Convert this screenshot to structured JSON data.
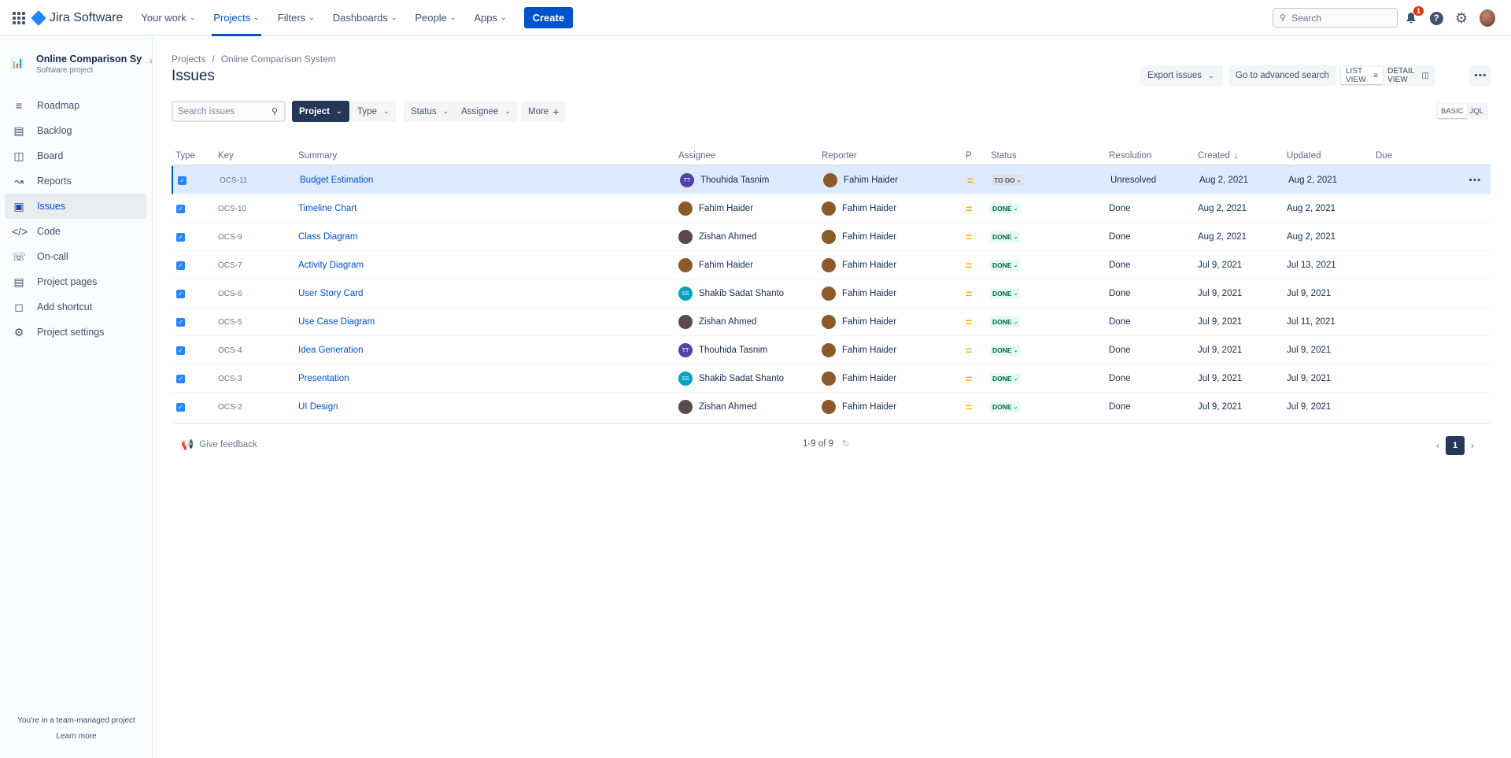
{
  "nav": {
    "logo": "Jira Software",
    "items": [
      {
        "label": "Your work"
      },
      {
        "label": "Projects",
        "active": true
      },
      {
        "label": "Filters"
      },
      {
        "label": "Dashboards"
      },
      {
        "label": "People"
      },
      {
        "label": "Apps"
      }
    ],
    "create": "Create",
    "search_placeholder": "Search",
    "notifications_count": "1",
    "help_icon": "?"
  },
  "sidebar": {
    "project_name": "Online Comparison Syst...",
    "project_type": "Software project",
    "items": [
      {
        "label": "Roadmap",
        "icon": "roadmap-icon"
      },
      {
        "label": "Backlog",
        "icon": "backlog-icon"
      },
      {
        "label": "Board",
        "icon": "board-icon"
      },
      {
        "label": "Reports",
        "icon": "reports-icon"
      },
      {
        "label": "Issues",
        "icon": "issues-icon",
        "active": true
      },
      {
        "label": "Code",
        "icon": "code-icon"
      },
      {
        "label": "On-call",
        "icon": "on-call-icon"
      },
      {
        "label": "Project pages",
        "icon": "pages-icon"
      },
      {
        "label": "Add shortcut",
        "icon": "add-shortcut-icon"
      },
      {
        "label": "Project settings",
        "icon": "settings-icon"
      }
    ],
    "footer_text": "You're in a team-managed project",
    "learn_more": "Learn more"
  },
  "main": {
    "breadcrumb": [
      "Projects",
      "Online Comparison System"
    ],
    "title": "Issues",
    "export": "Export issues",
    "advanced_search": "Go to advanced search",
    "list_view": "LIST VIEW",
    "detail_view": "DETAIL VIEW",
    "search_placeholder": "Search issues",
    "filters": {
      "project": "Project",
      "type": "Type",
      "status": "Status",
      "assignee": "Assignee",
      "more": "More"
    },
    "basic": "BASIC",
    "jql": "JQL"
  },
  "table": {
    "columns": {
      "type": "Type",
      "key": "Key",
      "summary": "Summary",
      "assignee": "Assignee",
      "reporter": "Reporter",
      "priority": "P",
      "status": "Status",
      "resolution": "Resolution",
      "created": "Created",
      "updated": "Updated",
      "due": "Due"
    },
    "rows": [
      {
        "key": "OCS-11",
        "summary": "Budget Estimation",
        "assignee": "Thouhida Tasnim",
        "assignee_initials": "TT",
        "assignee_color": "#5243aa",
        "reporter": "Fahim Haider",
        "status": "TO DO",
        "resolution": "Unresolved",
        "created": "Aug 2, 2021",
        "updated": "Aug 2, 2021"
      },
      {
        "key": "OCS-10",
        "summary": "Timeline Chart",
        "assignee": "Fahim Haider",
        "assignee_initials": "",
        "assignee_color": "#8b5a2b",
        "reporter": "Fahim Haider",
        "status": "DONE",
        "resolution": "Done",
        "created": "Aug 2, 2021",
        "updated": "Aug 2, 2021"
      },
      {
        "key": "OCS-9",
        "summary": "Class Diagram",
        "assignee": "Zishan Ahmed",
        "assignee_initials": "",
        "assignee_color": "#5a4a4a",
        "reporter": "Fahim Haider",
        "status": "DONE",
        "resolution": "Done",
        "created": "Aug 2, 2021",
        "updated": "Aug 2, 2021"
      },
      {
        "key": "OCS-7",
        "summary": "Activity Diagram",
        "assignee": "Fahim Haider",
        "assignee_initials": "",
        "assignee_color": "#8b5a2b",
        "reporter": "Fahim Haider",
        "status": "DONE",
        "resolution": "Done",
        "created": "Jul 9, 2021",
        "updated": "Jul 13, 2021"
      },
      {
        "key": "OCS-6",
        "summary": "User Story Card",
        "assignee": "Shakib Sadat Shanto",
        "assignee_initials": "SS",
        "assignee_color": "#00a3bf",
        "reporter": "Fahim Haider",
        "status": "DONE",
        "resolution": "Done",
        "created": "Jul 9, 2021",
        "updated": "Jul 9, 2021"
      },
      {
        "key": "OCS-5",
        "summary": "Use Case Diagram",
        "assignee": "Zishan Ahmed",
        "assignee_initials": "",
        "assignee_color": "#5a4a4a",
        "reporter": "Fahim Haider",
        "status": "DONE",
        "resolution": "Done",
        "created": "Jul 9, 2021",
        "updated": "Jul 11, 2021"
      },
      {
        "key": "OCS-4",
        "summary": "Idea Generation",
        "assignee": "Thouhida Tasnim",
        "assignee_initials": "TT",
        "assignee_color": "#5243aa",
        "reporter": "Fahim Haider",
        "status": "DONE",
        "resolution": "Done",
        "created": "Jul 9, 2021",
        "updated": "Jul 9, 2021"
      },
      {
        "key": "OCS-3",
        "summary": "Presentation",
        "assignee": "Shakib Sadat Shanto",
        "assignee_initials": "SS",
        "assignee_color": "#00a3bf",
        "reporter": "Fahim Haider",
        "status": "DONE",
        "resolution": "Done",
        "created": "Jul 9, 2021",
        "updated": "Jul 9, 2021"
      },
      {
        "key": "OCS-2",
        "summary": "UI Design",
        "assignee": "Zishan Ahmed",
        "assignee_initials": "",
        "assignee_color": "#5a4a4a",
        "reporter": "Fahim Haider",
        "status": "DONE",
        "resolution": "Done",
        "created": "Jul 9, 2021",
        "updated": "Jul 9, 2021"
      }
    ]
  },
  "footer": {
    "feedback": "Give feedback",
    "count": "1-9 of 9",
    "current_page": "1"
  },
  "colors": {
    "accent": "#0052cc",
    "done_bg": "#e3fcef",
    "done_text": "#006644",
    "priority_medium": "#ffab00"
  }
}
